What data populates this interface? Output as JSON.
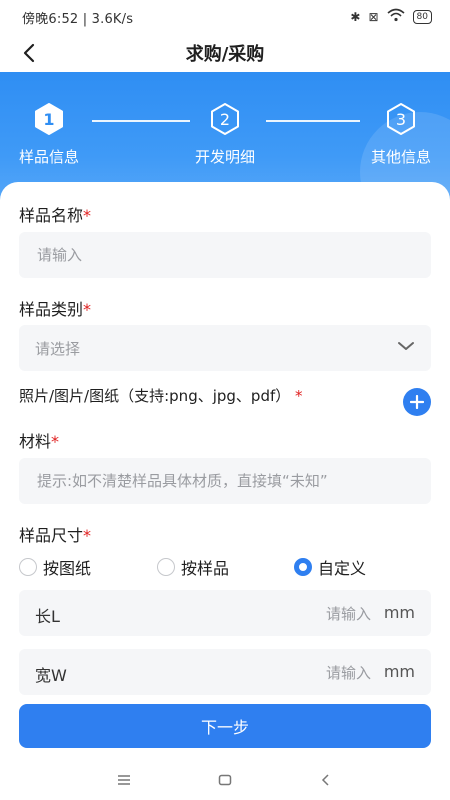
{
  "status_bar": {
    "left_text": "傍晚6:52 | 3.6K/s",
    "battery": "80"
  },
  "header": {
    "title": "求购/采购"
  },
  "steps": [
    {
      "number": "1",
      "label": "样品信息",
      "active": true
    },
    {
      "number": "2",
      "label": "开发明细",
      "active": false
    },
    {
      "number": "3",
      "label": "其他信息",
      "active": false
    }
  ],
  "form": {
    "sample_name": {
      "label": "样品名称",
      "required_mark": "*",
      "placeholder": "请输入"
    },
    "sample_category": {
      "label": "样品类别",
      "required_mark": "*",
      "placeholder": "请选择"
    },
    "photos": {
      "label": "照片/图片/图纸（支持:png、jpg、pdf）",
      "required_mark": "*"
    },
    "material": {
      "label": "材料",
      "required_mark": "*",
      "placeholder": "提示:如不清楚样品具体材质，直接填“未知”"
    },
    "sample_size": {
      "label": "样品尺寸",
      "required_mark": "*",
      "options": [
        {
          "label": "按图纸",
          "selected": false
        },
        {
          "label": "按样品",
          "selected": false
        },
        {
          "label": "自定义",
          "selected": true
        }
      ]
    },
    "length": {
      "label": "长L",
      "placeholder": "请输入",
      "unit": "mm"
    },
    "width": {
      "label": "宽W",
      "placeholder": "请输入",
      "unit": "mm"
    }
  },
  "next_button": "下一步",
  "colors": {
    "primary": "#2f7ff0",
    "required": "#e02020",
    "header_gradient": "#3f9af7"
  }
}
